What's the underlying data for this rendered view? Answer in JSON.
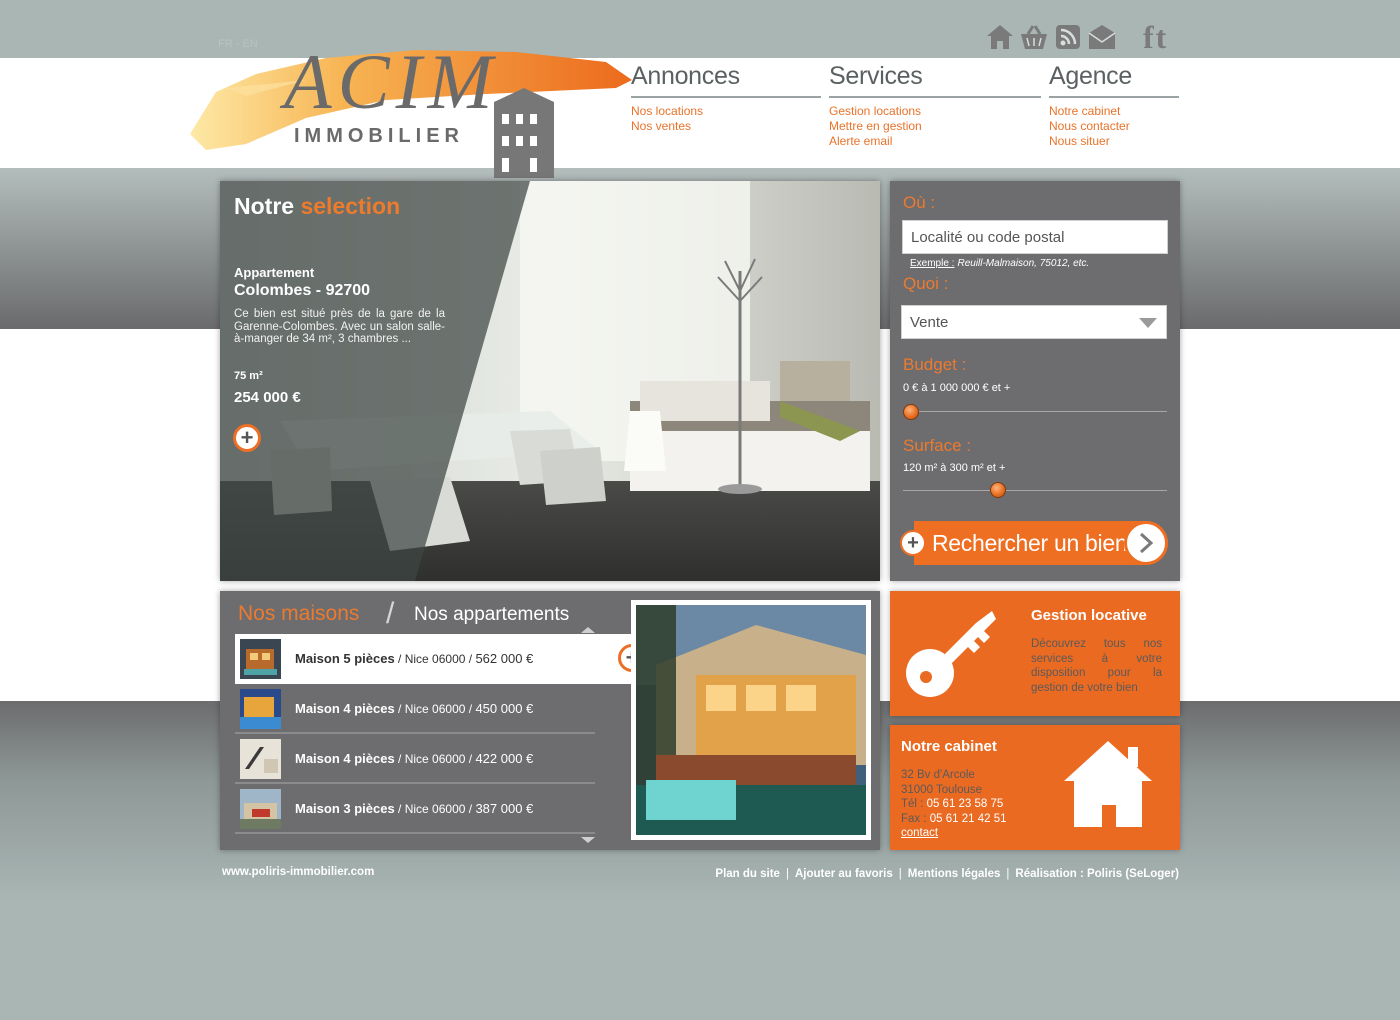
{
  "header": {
    "lang": "FR - EN",
    "logo_text": "ACIM",
    "logo_subtext": "IMMOBILIER",
    "icons": [
      "home-icon",
      "basket-icon",
      "rss-icon",
      "mail-icon"
    ],
    "social": [
      "f",
      "t"
    ]
  },
  "nav": {
    "annonces": {
      "title": "Annonces",
      "items": [
        "Nos locations",
        "Nos ventes"
      ]
    },
    "services": {
      "title": "Services",
      "items": [
        "Gestion locations",
        "Mettre en gestion",
        "Alerte email"
      ]
    },
    "agence": {
      "title": "Agence",
      "items": [
        "Notre cabinet",
        "Nous contacter",
        "Nous situer"
      ]
    }
  },
  "featured": {
    "title_main": "Notre",
    "title_accent": "selection",
    "type": "Appartement",
    "location": "Colombes - 92700",
    "description": "Ce bien est situé près de la gare de la Garenne-Colombes. Avec un salon salle-à-manger de 34 m², 3 chambres ...",
    "area": "75 m²",
    "price": "254 000 €"
  },
  "search": {
    "where_label": "Où :",
    "where_placeholder": "Localité ou code postal",
    "example_label": "Exemple :",
    "example_text": "Reuill-Malmaison, 75012, etc.",
    "what_label": "Quoi :",
    "what_value": "Vente",
    "budget_label": "Budget :",
    "budget_range": "0 € à 1 000 000 € et +",
    "budget_fraction": 0.0,
    "surface_label": "Surface :",
    "surface_range": "120 m² à 300 m² et +",
    "surface_fraction": 0.35,
    "button": "Rechercher un bien"
  },
  "listings": {
    "tab_maisons": "Nos maisons",
    "tab_separator": "/",
    "tab_apparts": "Nos appartements",
    "rows": [
      {
        "name": "Maison 5 pièces",
        "loc": " / Nice 06000 / ",
        "price": "562 000 €"
      },
      {
        "name": "Maison 4 pièces",
        "loc": " / Nice 06000 / ",
        "price": "450 000 €"
      },
      {
        "name": "Maison 4 pièces",
        "loc": " / Nice 06000 / ",
        "price": "422 000 €"
      },
      {
        "name": "Maison 3 pièces",
        "loc": " / Nice 06000 / ",
        "price": "387 000 €"
      }
    ]
  },
  "gestion": {
    "title": "Gestion locative",
    "text": "Découvrez tous nos services à votre disposition pour la gestion de votre bien"
  },
  "cabinet": {
    "title": "Notre cabinet",
    "address1": "32 Bv d'Arcole",
    "address2": "31000 Toulouse",
    "tel_label": "Tél : ",
    "tel": "05 61 23 58 75",
    "fax_label": "Fax : ",
    "fax": "05 61 21 42 51",
    "contact": "contact"
  },
  "footer": {
    "url": "www.poliris-immobilier.com",
    "links": [
      "Plan du site",
      "Ajouter au favoris",
      "Mentions légales",
      "Réalisation : Poliris (SeLoger)"
    ]
  },
  "colors": {
    "accent": "#ea6a22",
    "panel": "#6d6d6f",
    "background": "#a9b6b4"
  }
}
